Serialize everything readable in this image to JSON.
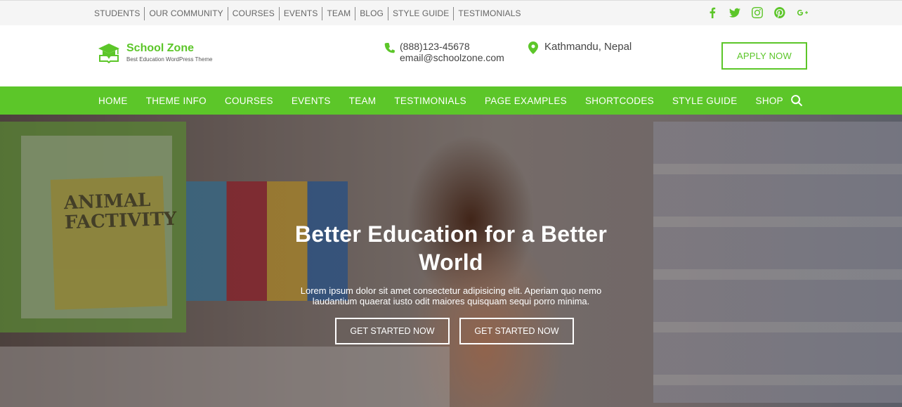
{
  "topbar": {
    "links": [
      "STUDENTS",
      "OUR COMMUNITY",
      "COURSES",
      "EVENTS",
      "TEAM",
      "BLOG",
      "STYLE GUIDE",
      "TESTIMONIALS"
    ],
    "social": [
      "facebook-icon",
      "twitter-icon",
      "instagram-icon",
      "pinterest-icon",
      "google-plus-icon"
    ]
  },
  "header": {
    "logo_title": "School Zone",
    "logo_subtitle": "Best Education WordPress Theme",
    "phone": "(888)123-45678",
    "email": "email@schoolzone.com",
    "location": "Kathmandu, Nepal",
    "apply_label": "APPLY NOW"
  },
  "nav": {
    "items": [
      "HOME",
      "THEME INFO",
      "COURSES",
      "EVENTS",
      "TEAM",
      "TESTIMONIALS",
      "PAGE EXAMPLES",
      "SHORTCODES",
      "STYLE GUIDE",
      "SHOP"
    ]
  },
  "hero": {
    "title": "Better Education for a Better World",
    "text": "Lorem ipsum dolor sit amet consectetur adipisicing elit. Aperiam quo nemo laudantium quaerat iusto odit maiores quisquam sequi porro minima.",
    "button1": "GET STARTED NOW",
    "button2": "GET STARTED NOW",
    "book_title": "ANIMAL FACTIVITY"
  },
  "colors": {
    "accent": "#5cc629",
    "topbar_bg": "#f5f5f5"
  }
}
